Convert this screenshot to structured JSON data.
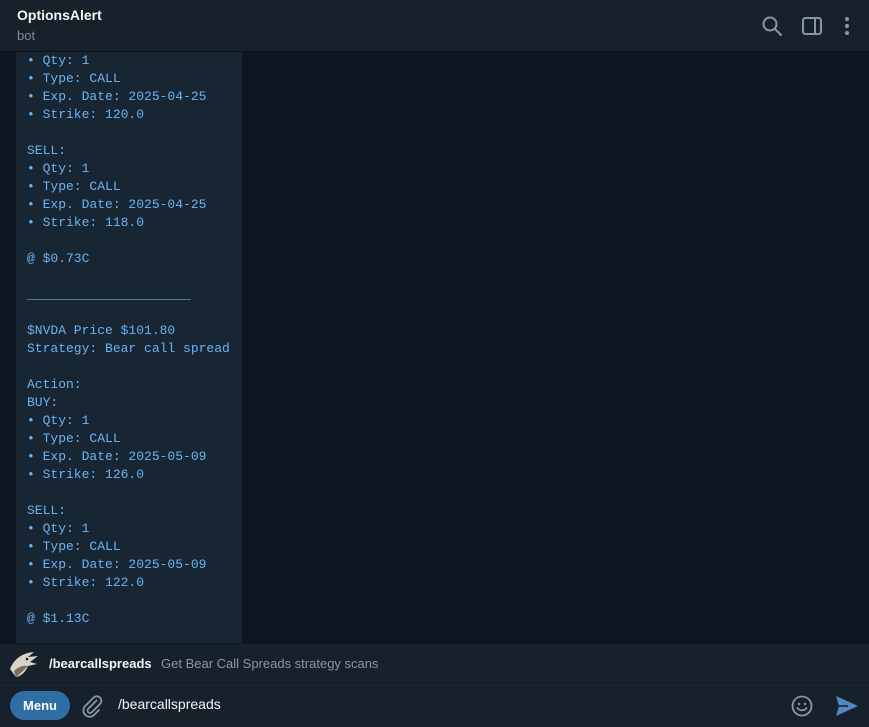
{
  "header": {
    "title": "OptionsAlert",
    "subtitle": "bot"
  },
  "message": {
    "text": "• Qty: 1\n• Type: CALL\n• Exp. Date: 2025-04-25\n• Strike: 120.0\n\nSELL:\n• Qty: 1\n• Type: CALL\n• Exp. Date: 2025-04-25\n• Strike: 118.0\n\n@ $0.73C\n\n_____________________\n\n$NVDA Price $101.80\nStrategy: Bear call spread\n\nAction:\nBUY:\n• Qty: 1\n• Type: CALL\n• Exp. Date: 2025-05-09\n• Strike: 126.0\n\nSELL:\n• Qty: 1\n• Type: CALL\n• Exp. Date: 2025-05-09\n• Strike: 122.0\n\n@ $1.13C"
  },
  "suggestion": {
    "command": "/bearcallspreads",
    "description": "Get Bear Call Spreads strategy scans"
  },
  "composer": {
    "menu_label": "Menu",
    "input_value": "/bearcallspreads"
  },
  "colors": {
    "background": "#0e1621",
    "panel": "#17212b",
    "bubble": "#182533",
    "accent": "#2f6ea5",
    "code_text": "#6ab3f3"
  },
  "icons": {
    "header": [
      "search-icon",
      "sidebar-toggle-icon",
      "more-vertical-icon"
    ],
    "composer": [
      "paperclip-icon",
      "emoji-icon",
      "send-icon"
    ]
  }
}
